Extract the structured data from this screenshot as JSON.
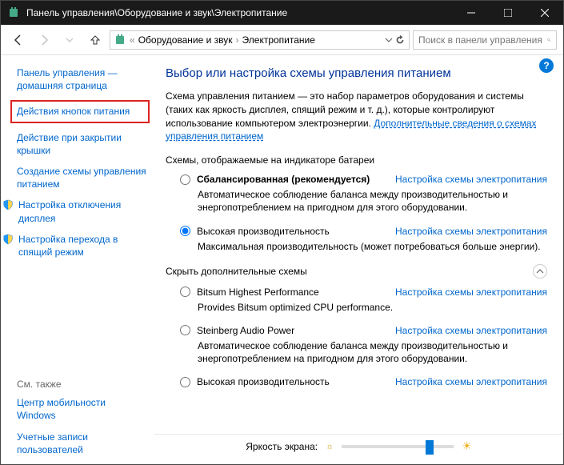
{
  "titlebar": {
    "text": "Панель управления\\Оборудование и звук\\Электропитание"
  },
  "breadcrumb": {
    "parent": "Оборудование и звук",
    "current": "Электропитание"
  },
  "search": {
    "placeholder": "Поиск в панели управления"
  },
  "sidebar": {
    "home": "Панель управления — домашняя страница",
    "items": [
      "Действия кнопок питания",
      "Действие при закрытии крышки",
      "Создание схемы управления питанием",
      "Настройка отключения дисплея",
      "Настройка перехода в спящий режим"
    ],
    "see_also_header": "См. также",
    "see_also": [
      "Центр мобильности Windows",
      "Учетные записи пользователей"
    ]
  },
  "main": {
    "title": "Выбор или настройка схемы управления питанием",
    "desc_prefix": "Схема управления питанием — это набор параметров оборудования и системы (таких как яркость дисплея, спящий режим и т. д.), которые контролируют использование компьютером электроэнергии. ",
    "desc_link": "Дополнительные сведения о схемах управления питанием",
    "section_battery": "Схемы, отображаемые на индикаторе батареи",
    "section_hidden": "Скрыть дополнительные схемы",
    "config_label": "Настройка схемы электропитания",
    "plans_battery": [
      {
        "name": "Сбалансированная (рекомендуется)",
        "bold": true,
        "selected": false,
        "desc": "Автоматическое соблюдение баланса между производительностью и энергопотреблением на пригодном для этого оборудовании."
      },
      {
        "name": "Высокая производительность",
        "bold": false,
        "selected": true,
        "desc": "Максимальная производительность (может потребоваться больше энергии)."
      }
    ],
    "plans_hidden": [
      {
        "name": "Bitsum Highest Performance",
        "selected": false,
        "desc": "Provides Bitsum optimized CPU performance."
      },
      {
        "name": "Steinberg Audio Power",
        "selected": false,
        "desc": "Автоматическое соблюдение баланса между производительностью и энергопотреблением на пригодном для этого оборудовании."
      },
      {
        "name": "Высокая производительность",
        "selected": false,
        "desc": ""
      }
    ],
    "brightness_label": "Яркость экрана:"
  }
}
